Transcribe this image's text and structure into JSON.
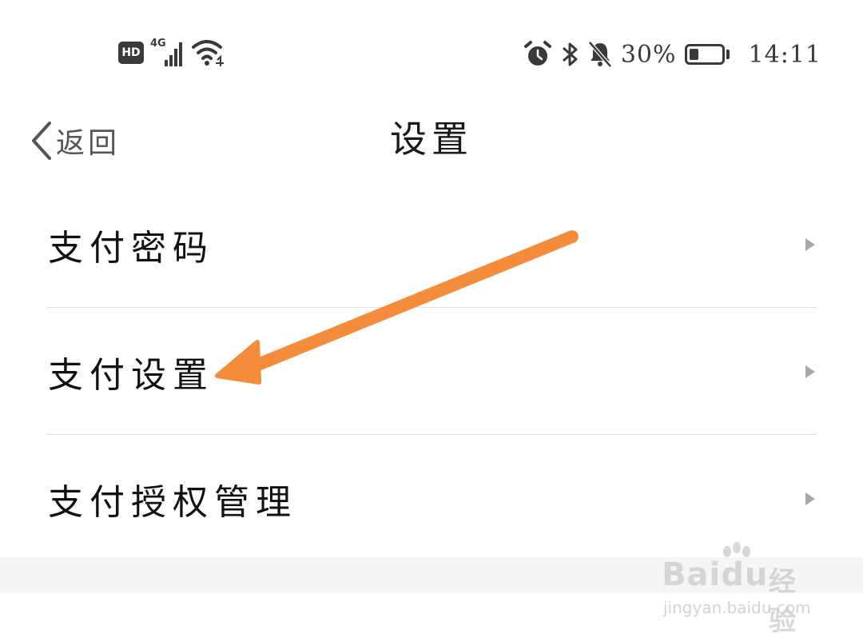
{
  "status_bar": {
    "hd": "HD",
    "network": "4G",
    "battery_percent": "30%",
    "battery_level": 0.3,
    "time": "14:11",
    "icons": [
      "signal-icon",
      "wifi-icon",
      "alarm-icon",
      "bluetooth-icon",
      "bell-muted-icon",
      "battery-icon"
    ]
  },
  "nav": {
    "back_label": "返回",
    "title": "设置"
  },
  "list": [
    {
      "label": "支付密码"
    },
    {
      "label": "支付设置"
    },
    {
      "label": "支付授权管理"
    }
  ],
  "watermark": {
    "brand": "Baidu",
    "sub": "经验",
    "url": "jingyan.baidu.com"
  },
  "colors": {
    "annotation_arrow": "#f58c3c",
    "chevron": "#a8a8a8",
    "divider": "#e2e2e2",
    "footer_bg": "#f4f5f7"
  }
}
